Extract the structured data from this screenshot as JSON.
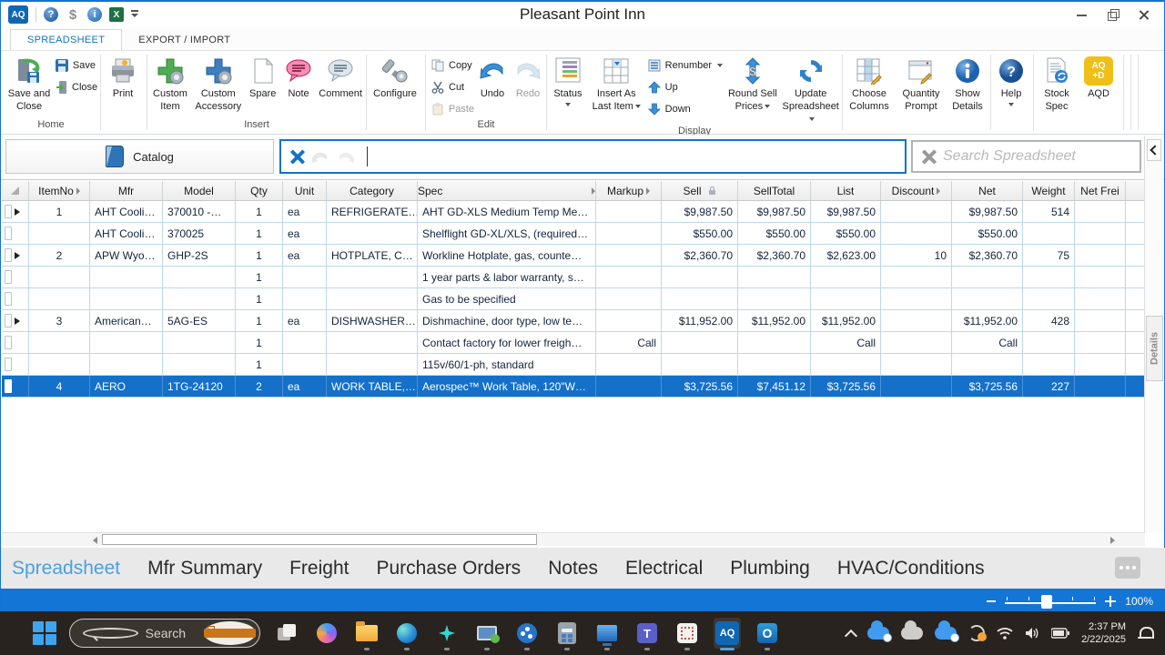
{
  "titlebar": {
    "title": "Pleasant Point Inn",
    "logo_text": "AQ",
    "excel_text": "X",
    "help_glyph": "?",
    "dollar_glyph": "$",
    "info_glyph": "i"
  },
  "ribbon_tabs": {
    "spreadsheet": "SPREADSHEET",
    "export_import": "EXPORT / IMPORT"
  },
  "ribbon": {
    "groups": {
      "home": "Home",
      "insert": "Insert",
      "edit": "Edit",
      "display": "Display"
    },
    "save_and_close": "Save and Close",
    "save": "Save",
    "close": "Close",
    "print": "Print",
    "custom_item": "Custom Item",
    "custom_accessory": "Custom Accessory",
    "spare": "Spare",
    "note": "Note",
    "comment": "Comment",
    "configure": "Configure",
    "copy": "Copy",
    "cut": "Cut",
    "paste": "Paste",
    "undo": "Undo",
    "redo": "Redo",
    "status": "Status",
    "insert_as_line1": "Insert As",
    "insert_as_line2": "Last Item",
    "renumber": "Renumber",
    "up": "Up",
    "down": "Down",
    "round_sell_line1": "Round Sell",
    "round_sell_line2": "Prices",
    "update_line1": "Update",
    "update_line2": "Spreadsheet",
    "choose_columns": "Choose Columns",
    "quantity_prompt": "Quantity Prompt",
    "show_details": "Show Details",
    "help": "Help",
    "stock_spec": "Stock Spec",
    "aqd": "AQD",
    "aqd_icon_line1": "AQ",
    "aqd_icon_line2": "+D"
  },
  "toolbar": {
    "catalog": "Catalog",
    "filter_value": "",
    "search_placeholder": "Search Spreadsheet"
  },
  "grid": {
    "columns": [
      "ItemNo",
      "Mfr",
      "Model",
      "Qty",
      "Unit",
      "Category",
      "Spec",
      "Markup",
      "Sell",
      "SellTotal",
      "List",
      "Discount",
      "Net",
      "Weight",
      "Net Frei"
    ],
    "rows": [
      {
        "expand": true,
        "selected": false,
        "cells": [
          "1",
          "AHT Cooli…",
          "370010 -…",
          "1",
          "ea",
          "REFRIGERATE…",
          "AHT GD-XLS Medium Temp Me…",
          "",
          "$9,987.50",
          "$9,987.50",
          "$9,987.50",
          "",
          "$9,987.50",
          "514",
          ""
        ]
      },
      {
        "expand": false,
        "selected": false,
        "cells": [
          "",
          "AHT Cooli…",
          "370025",
          "1",
          "ea",
          "",
          "Shelflight GD-XL/XLS, (required…",
          "",
          "$550.00",
          "$550.00",
          "$550.00",
          "",
          "$550.00",
          "",
          ""
        ]
      },
      {
        "expand": true,
        "selected": false,
        "cells": [
          "2",
          "APW Wyo…",
          "GHP-2S",
          "1",
          "ea",
          "HOTPLATE, C…",
          "Workline Hotplate, gas, counte…",
          "",
          "$2,360.70",
          "$2,360.70",
          "$2,623.00",
          "10",
          "$2,360.70",
          "75",
          ""
        ]
      },
      {
        "expand": false,
        "selected": false,
        "cells": [
          "",
          "",
          "",
          "1",
          "",
          "",
          "1 year parts & labor warranty, s…",
          "",
          "",
          "",
          "",
          "",
          "",
          "",
          ""
        ]
      },
      {
        "expand": false,
        "selected": false,
        "cells": [
          "",
          "",
          "",
          "1",
          "",
          "",
          "Gas to be specified",
          "",
          "",
          "",
          "",
          "",
          "",
          "",
          ""
        ]
      },
      {
        "expand": true,
        "selected": false,
        "cells": [
          "3",
          "American…",
          "5AG-ES",
          "1",
          "ea",
          "DISHWASHER…",
          "Dishmachine, door type, low te…",
          "",
          "$11,952.00",
          "$11,952.00",
          "$11,952.00",
          "",
          "$11,952.00",
          "428",
          ""
        ]
      },
      {
        "expand": false,
        "selected": false,
        "cells": [
          "",
          "",
          "",
          "1",
          "",
          "",
          "Contact factory for lower freigh…",
          "Call",
          "",
          "",
          "Call",
          "",
          "Call",
          "",
          ""
        ]
      },
      {
        "expand": false,
        "selected": false,
        "cells": [
          "",
          "",
          "",
          "1",
          "",
          "",
          "115v/60/1-ph, standard",
          "",
          "",
          "",
          "",
          "",
          "",
          "",
          ""
        ]
      },
      {
        "expand": false,
        "selected": true,
        "cells": [
          "4",
          "AERO",
          "1TG-24120",
          "2",
          "ea",
          "WORK TABLE,…",
          "Aerospec™ Work Table, 120\"W…",
          "",
          "$3,725.56",
          "$7,451.12",
          "$3,725.56",
          "",
          "$3,725.56",
          "227",
          ""
        ]
      }
    ]
  },
  "side_panel": {
    "details_tab": "Details"
  },
  "bottom_tabs": [
    {
      "label": "Spreadsheet",
      "active": true
    },
    {
      "label": "Mfr Summary",
      "active": false
    },
    {
      "label": "Freight",
      "active": false
    },
    {
      "label": "Purchase Orders",
      "active": false
    },
    {
      "label": "Notes",
      "active": false
    },
    {
      "label": "Electrical",
      "active": false
    },
    {
      "label": "Plumbing",
      "active": false
    },
    {
      "label": "HVAC/Conditions",
      "active": false
    }
  ],
  "statusbar": {
    "zoom": "100%"
  },
  "taskbar": {
    "search_label": "Search",
    "teams_glyph": "T",
    "outlook_glyph": "O",
    "aq_glyph": "AQ",
    "time": "2:37 PM",
    "date": "2/22/2025"
  }
}
